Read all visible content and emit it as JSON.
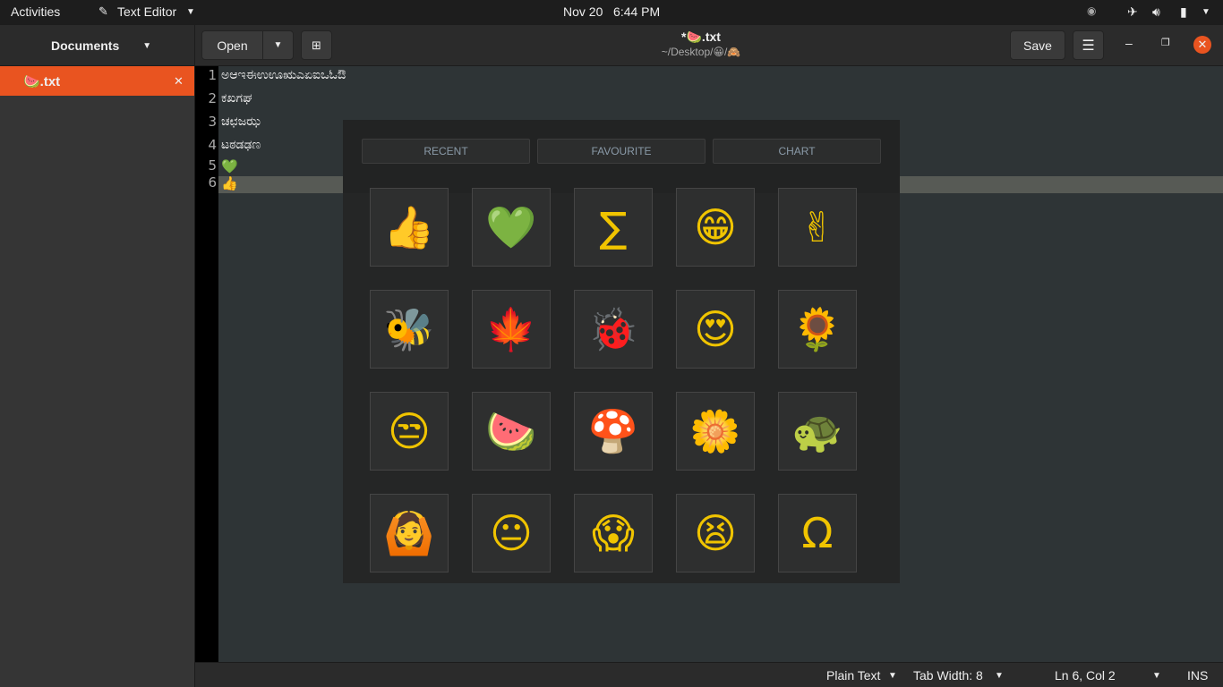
{
  "topbar": {
    "activities": "Activities",
    "app": "Text Editor",
    "clock": "Nov 20   6:44 PM"
  },
  "header": {
    "open": "Open",
    "title": "*🍉.txt",
    "subtitle": "~/Desktop/😀/🙈",
    "save": "Save"
  },
  "sidebar": {
    "title": "Documents",
    "doc": "🍉.txt"
  },
  "editor": {
    "lines": [
      "ಅಆಇಈಉಊಋಎಏಐಒಓಔ",
      "ಕಖಗಘ",
      "ಚಛಜಝ",
      "ಟಠಡಢಣ",
      "💚",
      "👍"
    ]
  },
  "picker": {
    "tabs": [
      "RECENT",
      "FAVOURITE",
      "CHART"
    ],
    "emojis": [
      [
        "👍",
        "💚",
        "∑",
        "😁",
        "✌"
      ],
      [
        "🐝",
        "🍁",
        "🐞",
        "😍",
        "🌻"
      ],
      [
        "😒",
        "🍉",
        "🍄",
        "🌼",
        "🐢"
      ],
      [
        "🙆",
        "😐",
        "😱",
        "😫",
        "Ω"
      ]
    ],
    "symbolic": [
      "∑",
      "😁",
      "✌",
      "😍",
      "😒",
      "😐",
      "😱",
      "😫",
      "Ω"
    ]
  },
  "status": {
    "lang": "Plain Text",
    "tab": "Tab Width: 8",
    "pos": "Ln 6, Col 2",
    "mode": "INS"
  }
}
